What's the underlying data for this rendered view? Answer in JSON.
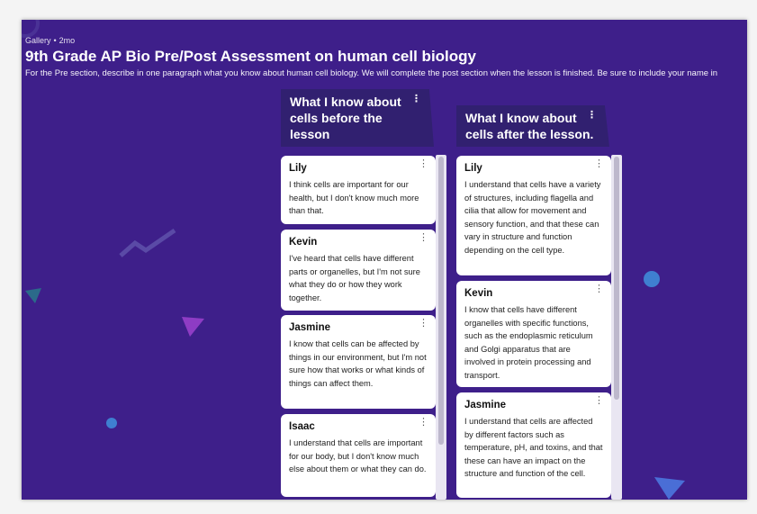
{
  "header": {
    "breadcrumb": "Gallery",
    "time": "2mo",
    "title": "9th Grade AP Bio Pre/Post Assessment on human cell biology",
    "description": "For the Pre section, describe in one paragraph what you know about human cell biology. We will complete the post section when the lesson is finished. Be sure to include your name in"
  },
  "columns": [
    {
      "title": "What I know about cells before the lesson",
      "posts": [
        {
          "name": "Lily",
          "text": "I think cells are important for our health, but I don't know much more than that."
        },
        {
          "name": "Kevin",
          "text": "I've heard that cells have different parts or organelles, but I'm not sure what they do or how they work together."
        },
        {
          "name": "Jasmine",
          "text": "I know that cells can be affected by things in our environment, but I'm not sure how that works or what kinds of things can affect them."
        },
        {
          "name": "Isaac",
          "text": "I understand that cells are important for our body, but I don't know much else about them or what they can do."
        }
      ]
    },
    {
      "title": "What I know about cells after the lesson.",
      "posts": [
        {
          "name": "Lily",
          "text": "I understand that cells have a variety of structures, including flagella and cilia that allow for movement and sensory function, and that these can vary in structure and function depending on the cell type."
        },
        {
          "name": "Kevin",
          "text": "I know that cells have different organelles with specific functions, such as the endoplasmic reticulum and Golgi apparatus that are involved in protein processing and transport."
        },
        {
          "name": "Jasmine",
          "text": "I understand that cells are affected by different factors such as temperature, pH, and toxins, and that these can have an impact on the structure and function of the cell."
        }
      ]
    }
  ],
  "icons": {
    "menu": "more-vertical-icon"
  },
  "colors": {
    "background": "#3e1f8a",
    "column_header": "#312070",
    "card": "#ffffff"
  }
}
